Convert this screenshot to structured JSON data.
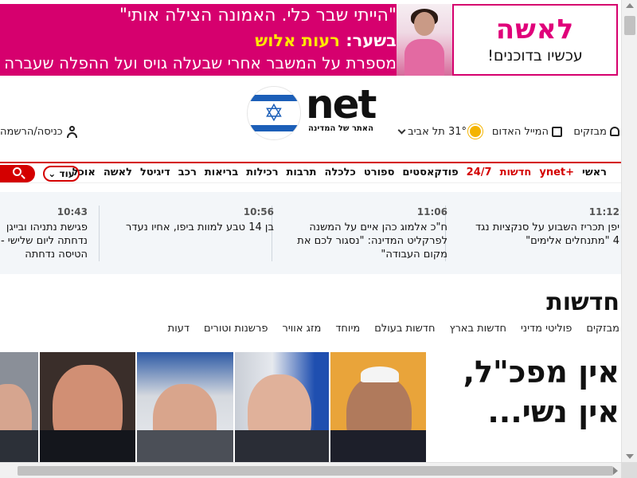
{
  "ad": {
    "line1": "\"הייתי שבר כלי. האמונה הצילה אותי\"",
    "line2_prefix": "בשער:",
    "line2_name": "רעות אלוש",
    "line3": "מספרת על המשבר אחרי שבעלה גויס ועל ההפלה שעברה",
    "logo": "לאשה",
    "cta": "עכשיו בדוכנים!"
  },
  "header": {
    "logo_word": "net",
    "logo_tagline": "האתר של המדינה",
    "flash": "מבזקים",
    "red_alert": "המייל האדום",
    "weather": "31° תל אביב",
    "login": "כניסה/הרשמה"
  },
  "nav": {
    "items": [
      "ראשי",
      "+ynet",
      "חדשות",
      "24/7",
      "פודקאסטים",
      "ספורט",
      "כלכלה",
      "תרבות",
      "רכילות",
      "בריאות",
      "רכב",
      "דיגיטל",
      "לאשה",
      "אוכל"
    ],
    "more": "עוד"
  },
  "ticker": [
    {
      "time": "11:12",
      "text": "יפן תכריז השבוע על סנקציות נגד 4 \"מתנחלים אלימים\""
    },
    {
      "time": "11:06",
      "text": "ח\"כ אלמוג כהן איים על המשנה לפרקליט המדינה: \"נסגור לכם את מקום העבודה\""
    },
    {
      "time": "10:56",
      "text": "בן 14 טבע למוות ביפו, אחיו נעדר"
    },
    {
      "time": "10:43",
      "text": "פגישת נתניהו ובייגן נדחתה ליום שלישי - הטיסה נדחתה למחר"
    }
  ],
  "section": {
    "title": "חדשות",
    "subnav": [
      "מבזקים",
      "פוליטי מדיני",
      "חדשות בארץ",
      "חדשות בעולם",
      "מיוחד",
      "מזג אוויר",
      "פרשנות וטורים",
      "דעות"
    ]
  },
  "headline": "אין מפכ\"ל, אין נשי...",
  "colors": {
    "brand_red": "#d40000",
    "ad_magenta": "#d6006e",
    "flag_blue": "#1c5fb8",
    "ticker_bg": "#f3f6f9"
  }
}
